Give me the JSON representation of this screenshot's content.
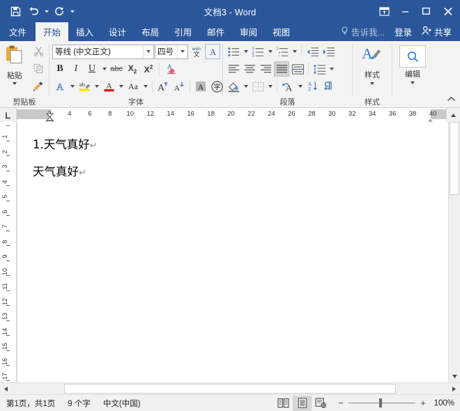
{
  "window": {
    "title": "文档3 - Word",
    "quick_access": [
      {
        "name": "save-icon",
        "label": "保存"
      },
      {
        "name": "undo-icon",
        "label": "撤消"
      },
      {
        "name": "redo-icon",
        "label": "恢复"
      },
      {
        "name": "customize-qat-icon",
        "label": "自定义快速访问工具栏"
      }
    ],
    "controls": [
      {
        "name": "ribbon-display-options-icon",
        "label": "功能区显示选项"
      },
      {
        "name": "minimize-icon",
        "label": "最小化"
      },
      {
        "name": "maximize-icon",
        "label": "最大化"
      },
      {
        "name": "close-icon",
        "label": "关闭"
      }
    ],
    "accent_color": "#2b579a"
  },
  "tabs": {
    "items": [
      {
        "label": "文件",
        "active": false
      },
      {
        "label": "开始",
        "active": true
      },
      {
        "label": "插入",
        "active": false
      },
      {
        "label": "设计",
        "active": false
      },
      {
        "label": "布局",
        "active": false
      },
      {
        "label": "引用",
        "active": false
      },
      {
        "label": "邮件",
        "active": false
      },
      {
        "label": "审阅",
        "active": false
      },
      {
        "label": "视图",
        "active": false
      }
    ],
    "tell_me": "告诉我...",
    "sign_in": "登录",
    "share": "共享"
  },
  "ribbon": {
    "clipboard": {
      "group_label": "剪贴板",
      "paste_label": "粘贴",
      "cut_label": "剪切",
      "copy_label": "复制",
      "format_painter_label": "格式刷"
    },
    "font": {
      "group_label": "字体",
      "font_name": "等线 (中文正文)",
      "font_size": "四号",
      "phonetic_guide_label": "拼音指南",
      "char_border_label": "字符边框",
      "bold_label": "B",
      "italic_label": "I",
      "underline_label": "U",
      "strikethrough_label": "abc",
      "subscript_label": "X₂",
      "superscript_label": "X²",
      "clear_format_label": "清除所有格式",
      "text_effects_label": "文本效果和版式",
      "highlight_label": "以不同颜色突出显示文本",
      "font_color_label": "字体颜色",
      "change_case_label": "Aa",
      "grow_font_label": "增大字号",
      "shrink_font_label": "减小字号",
      "char_shading_label": "字符底纹",
      "enclose_char_label": "带圈字符"
    },
    "paragraph": {
      "group_label": "段落",
      "bullets_label": "项目符号",
      "numbering_label": "编号",
      "multilevel_label": "多级列表",
      "decrease_indent_label": "减少缩进量",
      "increase_indent_label": "增加缩进量",
      "align_left_label": "左对齐",
      "align_center_label": "居中",
      "align_right_label": "右对齐",
      "justify_label": "两端对齐",
      "distribute_label": "分散对齐",
      "line_spacing_label": "行和段落间距",
      "shading_label": "底纹",
      "borders_label": "边框",
      "asian_layout_label": "中文版式",
      "sort_label": "排序",
      "show_marks_label": "显示/隐藏编辑标记",
      "active_alignment": "justify"
    },
    "styles": {
      "group_label": "样式",
      "button_label": "样式"
    },
    "editing": {
      "group_label": "编辑",
      "button_label": "编辑"
    },
    "collapse_label": "功能区折叠"
  },
  "ruler": {
    "tab_selector": "L",
    "h_numbers": [
      2,
      4,
      6,
      8,
      10,
      12,
      14,
      16,
      18,
      20,
      22,
      24,
      26,
      28,
      30,
      32,
      34,
      36,
      38,
      40
    ],
    "v_numbers": [
      1,
      2,
      3,
      4,
      5,
      6,
      7,
      8,
      9,
      10,
      11,
      12,
      13,
      14,
      15,
      16,
      17
    ]
  },
  "document": {
    "lines": [
      {
        "text": "1.天气真好",
        "mark": "↵"
      },
      {
        "text": "天气真好",
        "mark": "↵"
      }
    ]
  },
  "statusbar": {
    "page_info": "第1页，共1页",
    "word_count": "9 个字",
    "language": "中文(中国)",
    "views": [
      {
        "name": "read-mode-icon",
        "label": "阅读视图",
        "selected": false
      },
      {
        "name": "print-layout-icon",
        "label": "页面视图",
        "selected": true
      },
      {
        "name": "web-layout-icon",
        "label": "Web 版式视图",
        "selected": false
      }
    ],
    "zoom_out": "−",
    "zoom_in": "+",
    "zoom_level": "100%"
  }
}
